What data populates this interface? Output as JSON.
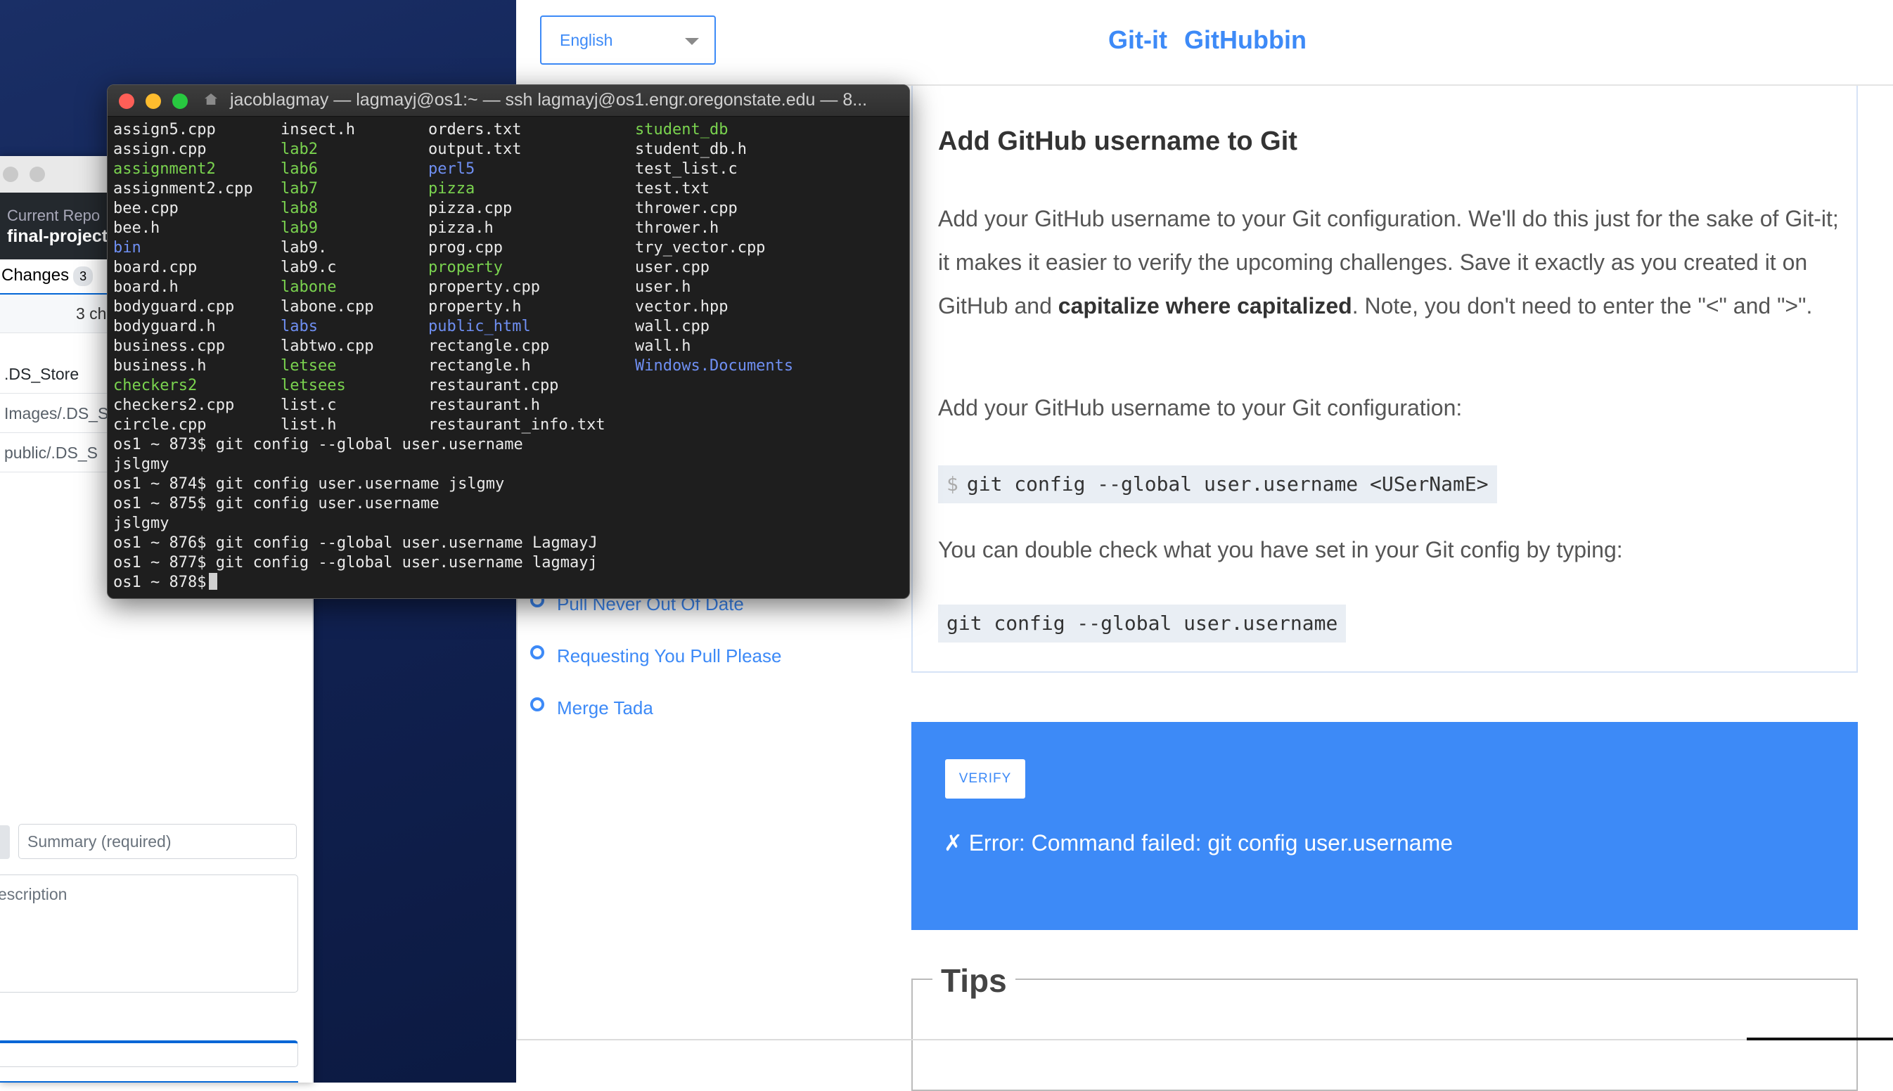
{
  "ghdesktop": {
    "repo_label": "Current Repo",
    "repo_name": "final-project",
    "changes_tab": "Changes",
    "changes_count": "3",
    "files_changed": "3 ch",
    "files": [
      ".DS_Store",
      "Images/.DS_S",
      "public/.DS_S"
    ],
    "summary_placeholder": "Summary (required)",
    "description_placeholder": "escription"
  },
  "gitit": {
    "language": "English",
    "brand_1": "Git-it",
    "brand_2": "GitHubbin",
    "heading": "Add GitHub username to Git",
    "para1_a": "Add your GitHub username to your Git configuration. We'll do this just for the sake of Git-it; it makes it easier to verify the upcoming challenges. Save it exactly as you created it on GitHub and ",
    "para1_bold": "capitalize where capitalized",
    "para1_b": ". Note, you don't need to enter the \"<\" and \">\".",
    "para2": "Add your GitHub username to your Git configuration:",
    "code1_prompt": "$",
    "code1": "git config --global user.username <USerNamE>",
    "para3": "You can double check what you have set in your Git config by typing:",
    "code2": "git config --global user.username",
    "challenges": [
      "Pull Never Out Of Date",
      "Requesting You Pull Please",
      "Merge Tada"
    ],
    "verify_label": "VERIFY",
    "verify_error": "✗ Error: Command failed: git config user.username",
    "tips_title": "Tips",
    "accent_color": "#3d8af7"
  },
  "terminal": {
    "title": "jacoblagmay — lagmayj@os1:~ — ssh lagmayj@os1.engr.oregonstate.edu — 8...",
    "ls_rows": [
      [
        {
          "t": "assign5.cpp",
          "c": ""
        },
        {
          "t": "insect.h",
          "c": ""
        },
        {
          "t": "orders.txt",
          "c": ""
        },
        {
          "t": "student_db",
          "c": "g"
        }
      ],
      [
        {
          "t": "assign.cpp",
          "c": ""
        },
        {
          "t": "lab2",
          "c": "g"
        },
        {
          "t": "output.txt",
          "c": ""
        },
        {
          "t": "student_db.h",
          "c": ""
        }
      ],
      [
        {
          "t": "assignment2",
          "c": "g"
        },
        {
          "t": "lab6",
          "c": "g"
        },
        {
          "t": "perl5",
          "c": "b"
        },
        {
          "t": "test_list.c",
          "c": ""
        }
      ],
      [
        {
          "t": "assignment2.cpp",
          "c": ""
        },
        {
          "t": "lab7",
          "c": "g"
        },
        {
          "t": "pizza",
          "c": "g"
        },
        {
          "t": "test.txt",
          "c": ""
        }
      ],
      [
        {
          "t": "bee.cpp",
          "c": ""
        },
        {
          "t": "lab8",
          "c": "g"
        },
        {
          "t": "pizza.cpp",
          "c": ""
        },
        {
          "t": "thrower.cpp",
          "c": ""
        }
      ],
      [
        {
          "t": "bee.h",
          "c": ""
        },
        {
          "t": "lab9",
          "c": "g"
        },
        {
          "t": "pizza.h",
          "c": ""
        },
        {
          "t": "thrower.h",
          "c": ""
        }
      ],
      [
        {
          "t": "bin",
          "c": "b"
        },
        {
          "t": "lab9.",
          "c": ""
        },
        {
          "t": "prog.cpp",
          "c": ""
        },
        {
          "t": "try_vector.cpp",
          "c": ""
        }
      ],
      [
        {
          "t": "board.cpp",
          "c": ""
        },
        {
          "t": "lab9.c",
          "c": ""
        },
        {
          "t": "property",
          "c": "g"
        },
        {
          "t": "user.cpp",
          "c": ""
        }
      ],
      [
        {
          "t": "board.h",
          "c": ""
        },
        {
          "t": "labone",
          "c": "g"
        },
        {
          "t": "property.cpp",
          "c": ""
        },
        {
          "t": "user.h",
          "c": ""
        }
      ],
      [
        {
          "t": "bodyguard.cpp",
          "c": ""
        },
        {
          "t": "labone.cpp",
          "c": ""
        },
        {
          "t": "property.h",
          "c": ""
        },
        {
          "t": "vector.hpp",
          "c": ""
        }
      ],
      [
        {
          "t": "bodyguard.h",
          "c": ""
        },
        {
          "t": "labs",
          "c": "b"
        },
        {
          "t": "public_html",
          "c": "b"
        },
        {
          "t": "wall.cpp",
          "c": ""
        }
      ],
      [
        {
          "t": "business.cpp",
          "c": ""
        },
        {
          "t": "labtwo.cpp",
          "c": ""
        },
        {
          "t": "rectangle.cpp",
          "c": ""
        },
        {
          "t": "wall.h",
          "c": ""
        }
      ],
      [
        {
          "t": "business.h",
          "c": ""
        },
        {
          "t": "letsee",
          "c": "g"
        },
        {
          "t": "rectangle.h",
          "c": ""
        },
        {
          "t": "Windows.Documents",
          "c": "b"
        }
      ],
      [
        {
          "t": "checkers2",
          "c": "g"
        },
        {
          "t": "letsees",
          "c": "g"
        },
        {
          "t": "restaurant.cpp",
          "c": ""
        },
        {
          "t": "",
          "c": ""
        }
      ],
      [
        {
          "t": "checkers2.cpp",
          "c": ""
        },
        {
          "t": "list.c",
          "c": ""
        },
        {
          "t": "restaurant.h",
          "c": ""
        },
        {
          "t": "",
          "c": ""
        }
      ],
      [
        {
          "t": "circle.cpp",
          "c": ""
        },
        {
          "t": "list.h",
          "c": ""
        },
        {
          "t": "restaurant_info.txt",
          "c": ""
        },
        {
          "t": "",
          "c": ""
        }
      ]
    ],
    "commands": [
      "os1 ~ 873$ git config --global user.username",
      "jslgmy",
      "os1 ~ 874$ git config user.username jslgmy",
      "os1 ~ 875$ git config user.username",
      "jslgmy",
      "os1 ~ 876$ git config --global user.username LagmayJ",
      "os1 ~ 877$ git config --global user.username lagmayj"
    ],
    "prompt": "os1 ~ 878$"
  }
}
